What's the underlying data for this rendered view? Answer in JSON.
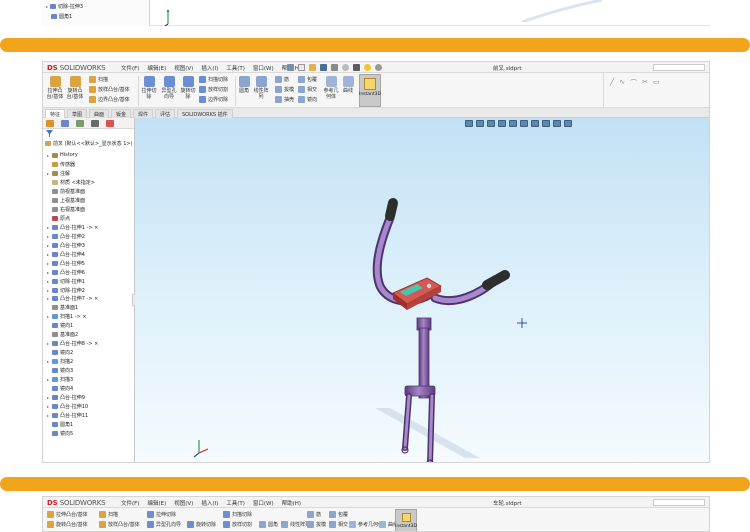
{
  "top_fragment": {
    "rows": [
      {
        "icon": "cut-extrude-icon",
        "label": "切除-拉伸3"
      },
      {
        "icon": "fillet-icon",
        "label": "圆角1"
      }
    ]
  },
  "windows": [
    {
      "app": {
        "logo_ds": "DS",
        "logo_brand": "SOLIDWORKS"
      },
      "menus": [
        "文件(F)",
        "编辑(E)",
        "视图(V)",
        "插入(I)",
        "工具(T)",
        "窗口(W)",
        "帮助(H)"
      ],
      "doc_title": "前叉.sldprt",
      "ribbon": {
        "big_buttons": [
          {
            "name": "extrude-boss-button",
            "label": "拉伸凸台/基体",
            "color": "#d9a441"
          },
          {
            "name": "revolve-boss-button",
            "label": "旋转凸台/基体",
            "color": "#d9a441"
          },
          {
            "name": "extrude-cut-button",
            "label": "拉伸切除",
            "color": "#6c8fd1"
          },
          {
            "name": "hole-wizard-button",
            "label": "异型孔向导",
            "color": "#6c8fd1"
          },
          {
            "name": "revolve-cut-button",
            "label": "旋转切除",
            "color": "#6c8fd1"
          },
          {
            "name": "fillet-button",
            "label": "圆角",
            "color": "#8aa6cf"
          },
          {
            "name": "linear-pattern-button",
            "label": "线性阵列",
            "color": "#8aa6cf"
          },
          {
            "name": "ref-geometry-button",
            "label": "参考几何体",
            "color": "#9fb4d6"
          },
          {
            "name": "curves-button",
            "label": "曲线",
            "color": "#9fb4d6"
          }
        ],
        "small_buttons": [
          {
            "name": "sweep-button",
            "label": "扫描"
          },
          {
            "name": "loft-boss-button",
            "label": "放样凸台/基体"
          },
          {
            "name": "boundary-boss-button",
            "label": "边界凸台/基体"
          },
          {
            "name": "swept-cut-button",
            "label": "扫描切除"
          },
          {
            "name": "lofted-cut-button",
            "label": "放样切割"
          },
          {
            "name": "boundary-cut-button",
            "label": "边界切除"
          },
          {
            "name": "rib-button",
            "label": "筋"
          },
          {
            "name": "draft-button",
            "label": "拔模"
          },
          {
            "name": "shell-button",
            "label": "抽壳"
          },
          {
            "name": "wrap-button",
            "label": "包覆"
          },
          {
            "name": "intersect-button",
            "label": "相交"
          },
          {
            "name": "mirror-button",
            "label": "镜向"
          }
        ],
        "instant3d": "Instant3D"
      },
      "tabs": [
        "特征",
        "草图",
        "曲面",
        "钣金",
        "焊件",
        "评估",
        "SOLIDWORKS 插件"
      ],
      "tree": {
        "root": "前叉 (默认<<默认>_显示状态 1>)",
        "rows": [
          {
            "ex": "▸",
            "icon": "history-icon",
            "label": "History",
            "color": "#a58a4f"
          },
          {
            "ex": "",
            "icon": "sensors-icon",
            "label": "传感器",
            "color": "#c79a3c"
          },
          {
            "ex": "▸",
            "icon": "annotations-icon",
            "label": "注解",
            "color": "#a58a4f"
          },
          {
            "ex": "",
            "icon": "material-icon",
            "label": "材质 <未指定>",
            "color": "#c9b27c"
          },
          {
            "ex": "",
            "icon": "plane-icon",
            "label": "前视基准面",
            "color": "#8f8f8f"
          },
          {
            "ex": "",
            "icon": "plane-icon",
            "label": "上视基准面",
            "color": "#8f8f8f"
          },
          {
            "ex": "",
            "icon": "plane-icon",
            "label": "右视基准面",
            "color": "#8f8f8f"
          },
          {
            "ex": "",
            "icon": "origin-icon",
            "label": "原点",
            "color": "#b84a4a"
          },
          {
            "ex": "▸",
            "icon": "boss-extrude-icon",
            "label": "凸台-拉伸1 -> ×",
            "color": "#6a86c9"
          },
          {
            "ex": "▸",
            "icon": "boss-extrude-icon",
            "label": "凸台-拉伸2",
            "color": "#6a86c9"
          },
          {
            "ex": "▸",
            "icon": "boss-extrude-icon",
            "label": "凸台-拉伸3",
            "color": "#6a86c9"
          },
          {
            "ex": "▸",
            "icon": "boss-extrude-icon",
            "label": "凸台-拉伸4",
            "color": "#6a86c9"
          },
          {
            "ex": "▸",
            "icon": "boss-extrude-icon",
            "label": "凸台-拉伸5",
            "color": "#6a86c9"
          },
          {
            "ex": "▸",
            "icon": "boss-extrude-icon",
            "label": "凸台-拉伸6",
            "color": "#6a86c9"
          },
          {
            "ex": "▸",
            "icon": "cut-extrude-icon",
            "label": "切除-拉伸1",
            "color": "#6a86c9"
          },
          {
            "ex": "▸",
            "icon": "cut-extrude-icon",
            "label": "切除-拉伸2",
            "color": "#6a86c9"
          },
          {
            "ex": "▸",
            "icon": "boss-extrude-icon",
            "label": "凸台-拉伸7 -> ×",
            "color": "#6a86c9"
          },
          {
            "ex": "",
            "icon": "plane-icon",
            "label": "基准面1",
            "color": "#8f8f8f"
          },
          {
            "ex": "▸",
            "icon": "sweep-icon",
            "label": "扫描1 -> ×",
            "color": "#5e9bd6"
          },
          {
            "ex": "",
            "icon": "mirror-icon",
            "label": "镜向1",
            "color": "#6a86c9"
          },
          {
            "ex": "",
            "icon": "plane-icon",
            "label": "基准面2",
            "color": "#8f8f8f"
          },
          {
            "ex": "▸",
            "icon": "boss-extrude-icon",
            "label": "凸台-拉伸8 -> ×",
            "color": "#6a86c9"
          },
          {
            "ex": "",
            "icon": "mirror-icon",
            "label": "镜向2",
            "color": "#6a86c9"
          },
          {
            "ex": "▸",
            "icon": "sweep-icon",
            "label": "扫描2",
            "color": "#5e9bd6"
          },
          {
            "ex": "",
            "icon": "mirror-icon",
            "label": "镜向3",
            "color": "#6a86c9"
          },
          {
            "ex": "▸",
            "icon": "sweep-icon",
            "label": "扫描3",
            "color": "#5e9bd6"
          },
          {
            "ex": "",
            "icon": "mirror-icon",
            "label": "镜向4",
            "color": "#6a86c9"
          },
          {
            "ex": "▸",
            "icon": "boss-extrude-icon",
            "label": "凸台-拉伸9",
            "color": "#6a86c9"
          },
          {
            "ex": "▸",
            "icon": "boss-extrude-icon",
            "label": "凸台-拉伸10",
            "color": "#6a86c9"
          },
          {
            "ex": "▸",
            "icon": "boss-extrude-icon",
            "label": "凸台-拉伸11",
            "color": "#6a86c9"
          },
          {
            "ex": "",
            "icon": "fillet-icon",
            "label": "圆角1",
            "color": "#6a86c9"
          },
          {
            "ex": "",
            "icon": "mirror-icon",
            "label": "镜向5",
            "color": "#6a86c9"
          }
        ]
      }
    },
    {
      "app": {
        "logo_ds": "DS",
        "logo_brand": "SOLIDWORKS"
      },
      "menus": [
        "文件(F)",
        "编辑(E)",
        "视图(V)",
        "插入(I)",
        "工具(T)",
        "窗口(W)",
        "帮助(H)"
      ],
      "doc_title": "车轮.sldprt",
      "ribbon_labels": {
        "sweep": "扫描",
        "swept_cut": "扫描切除",
        "rib": "筋",
        "wrap": "包覆",
        "extrude_boss": "拉伸凸台/基体",
        "revolve_boss": "旋转凸台/基体",
        "loft_boss": "放样凸台/基体",
        "extrude_cut": "拉伸切除",
        "hole_wizard": "异型孔向导",
        "revolve_cut": "旋转切除",
        "lofted_cut": "放样切割",
        "fillet": "圆角",
        "linear_pattern": "线性阵列",
        "draft": "拔模",
        "intersect": "相交",
        "ref_geometry": "参考几何体",
        "curves": "曲线",
        "instant3d": "Instant3D"
      }
    }
  ],
  "colors": {
    "divider": "#f2a41b",
    "brand_red": "#d32027",
    "viewport_top": "#c2e1f5",
    "viewport_bottom": "#f5fbfe",
    "model_purple": "#8a64ad",
    "model_grip": "#3a3a3a",
    "model_display": "#c8463d",
    "model_lcd": "#4bc4b0"
  }
}
